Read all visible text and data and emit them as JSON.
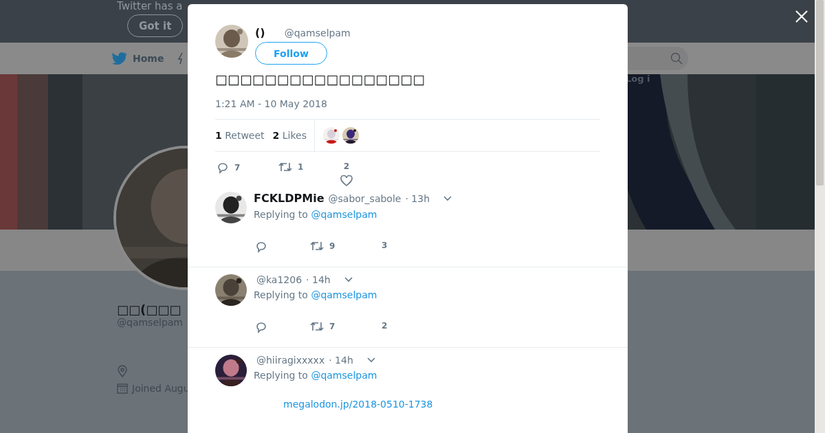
{
  "notice": {
    "text": "Twitter has a",
    "button": "Got it"
  },
  "nav": {
    "home": "Home",
    "login": "Log i"
  },
  "profile": {
    "name": "□□(□□□",
    "handle": "@qamselpam",
    "joined": "Joined Augu"
  },
  "tweet": {
    "name": "()",
    "handle": "@qamselpam",
    "follow": "Follow",
    "text": "□□□□□□□□□□□□□□□□□",
    "time": "1:21 AM - 10 May 2018",
    "retweets": {
      "count": "1",
      "label": "Retweet"
    },
    "likes": {
      "count": "2",
      "label": "Likes"
    },
    "actions": {
      "replies": "7",
      "retweets": "1",
      "likes": "2"
    }
  },
  "replies": [
    {
      "name": "FCKLDPMie",
      "handle": "@sabor_sabole",
      "time": "· 13h",
      "replying_label": "Replying to",
      "replying_to": "@qamselpam",
      "retweets": "9",
      "likes": "3"
    },
    {
      "handle": "@ka1206",
      "time": "· 14h",
      "replying_label": "Replying to",
      "replying_to": "@qamselpam",
      "retweets": "7",
      "likes": "2"
    },
    {
      "handle": "@hiiragixxxxx",
      "time": "· 14h",
      "replying_label": "Replying to",
      "replying_to": "@qamselpam",
      "link": "megalodon.jp/2018-0510-1738"
    }
  ]
}
